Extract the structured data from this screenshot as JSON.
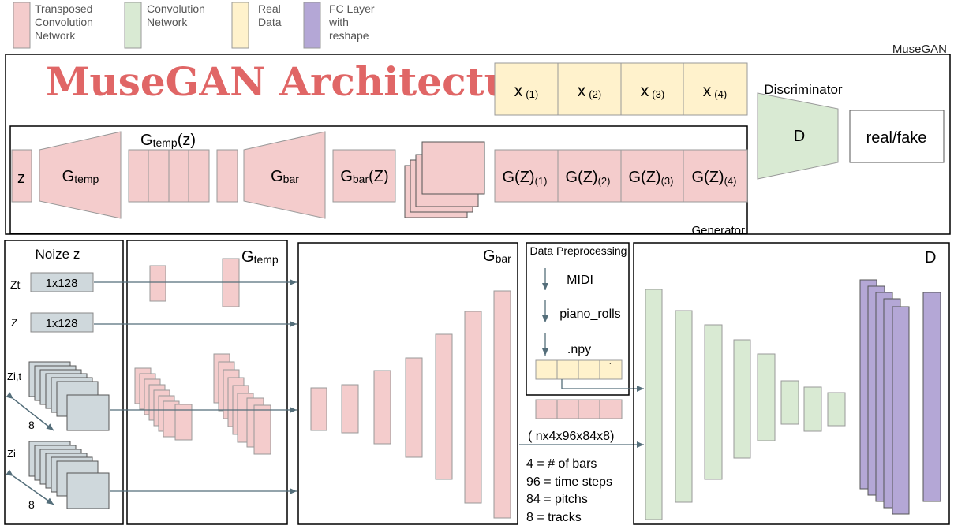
{
  "legend": [
    {
      "label_lines": [
        "Transposed",
        "Convolution",
        "Network"
      ],
      "color": "#f4cccc"
    },
    {
      "label_lines": [
        "Convolution",
        "Network"
      ],
      "color": "#d9ead3"
    },
    {
      "label_lines": [
        "Real",
        "Data"
      ],
      "color": "#fff2cc"
    },
    {
      "label_lines": [
        "FC Layer",
        "with",
        "reshape"
      ],
      "color": "#b4a7d6"
    }
  ],
  "colors": {
    "pink": "#f4cccc",
    "green": "#d9ead3",
    "yellow": "#fff2cc",
    "purple": "#b4a7d6",
    "gray": "#cfd8dc",
    "title": "#e06666",
    "arrow": "#546e7a"
  },
  "top": {
    "title": "MuseGAN Architecture",
    "musegan_label": "MuseGAN",
    "generator_label": "Generator",
    "discriminator_label": "Discriminator",
    "z": "z",
    "g_temp": {
      "main": "G",
      "sub": "temp"
    },
    "g_temp_z": {
      "main": "G",
      "sub": "temp",
      "suffix": "(z)"
    },
    "g_bar": {
      "main": "G",
      "sub": "bar"
    },
    "g_bar_z": {
      "main": "G",
      "sub": "bar",
      "suffix": "(Z)"
    },
    "real_cells": [
      {
        "main": "x",
        "sub": "(1)"
      },
      {
        "main": "x",
        "sub": "(2)"
      },
      {
        "main": "x",
        "sub": "(3)"
      },
      {
        "main": "x",
        "sub": "(4)"
      }
    ],
    "gen_cells": [
      {
        "main": "G(Z)",
        "sub": "(1)"
      },
      {
        "main": "G(Z)",
        "sub": "(2)"
      },
      {
        "main": "G(Z)",
        "sub": "(3)"
      },
      {
        "main": "G(Z)",
        "sub": "(4)"
      }
    ],
    "d": "D",
    "real_fake": "real/fake"
  },
  "bottom": {
    "noize_title": "Noize z",
    "zt": "Zt",
    "z": "Z",
    "zit": "Zi,t",
    "zi": "Zi",
    "dim_1x128": "1x128",
    "dim_8": "8",
    "g_temp": {
      "main": "G",
      "sub": "temp"
    },
    "g_bar": {
      "main": "G",
      "sub": "bar"
    },
    "data_prep_title": "Data Preprocessing",
    "data_prep_steps": [
      "MIDI",
      "piano_rolls",
      ".npy"
    ],
    "tensor_cell_mark": "`",
    "shape": "( nx4x96x84x8)",
    "notes": [
      "4 = # of bars",
      "96 = time steps",
      "84 = pitchs",
      "8 = tracks"
    ],
    "d": "D"
  }
}
